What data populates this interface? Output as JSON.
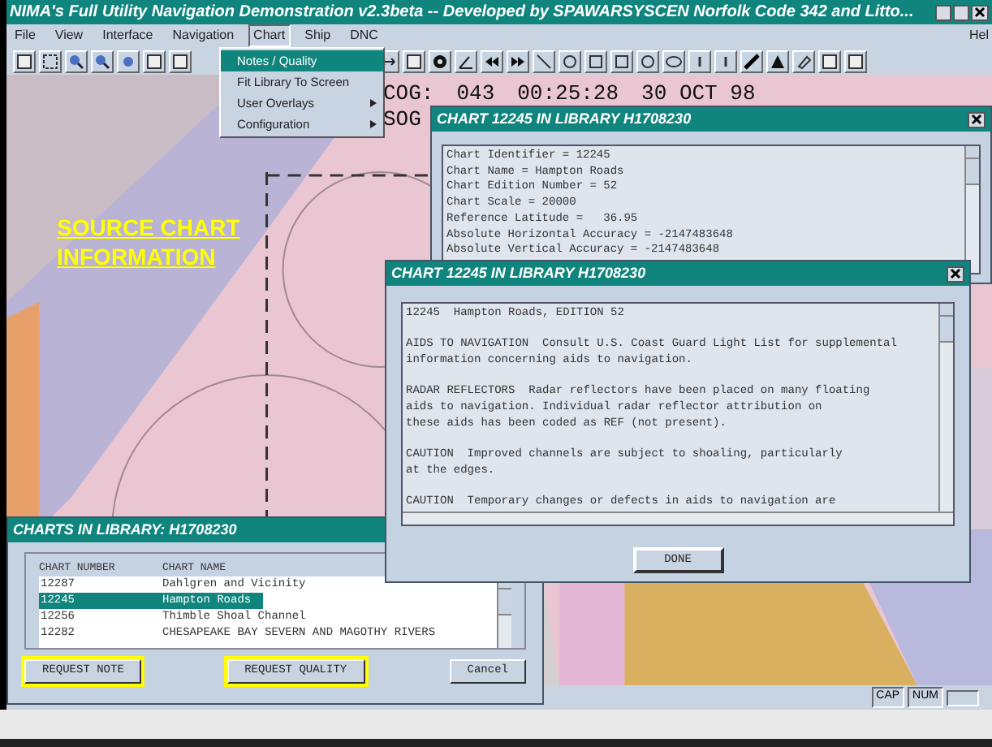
{
  "window": {
    "title": "NIMA's Full Utility Navigation Demonstration  v2.3beta -- Developed by SPAWARSYSCEN Norfolk Code 342 and Litto..."
  },
  "menu_bar": [
    {
      "label": "File",
      "selected": false
    },
    {
      "label": "View",
      "selected": false
    },
    {
      "label": "Interface",
      "selected": false
    },
    {
      "label": "Navigation",
      "selected": false
    },
    {
      "label": "Chart",
      "selected": true
    },
    {
      "label": "Ship",
      "selected": false
    },
    {
      "label": "DNC",
      "selected": false
    }
  ],
  "help_menu": "Hel",
  "chart_menu": [
    {
      "label": "Notes / Quality",
      "selected": true,
      "submenu": false
    },
    {
      "label": "Fit Library To Screen",
      "selected": false,
      "submenu": false
    },
    {
      "label": "User Overlays",
      "selected": false,
      "submenu": true
    },
    {
      "label": "Configuration",
      "selected": false,
      "submenu": true
    }
  ],
  "nav_readout": {
    "cog_label": "COG:",
    "cog": "043",
    "time": "00:25:28",
    "date": "30 OCT 98",
    "sog_label": "SOG"
  },
  "annotation": "SOURCE CHART INFORMATION",
  "info_window": {
    "title": "CHART 12245 IN LIBRARY H1708230",
    "lines": [
      "Chart Identifier = 12245",
      "Chart Name = Hampton Roads",
      "Chart Edition Number = 52",
      "Chart Scale = 20000",
      "Reference Latitude =   36.95",
      "Absolute Horizontal Accuracy = -2147483648",
      "Absolute Vertical Accuracy = -2147483648"
    ]
  },
  "notes_window": {
    "title": "CHART 12245 IN LIBRARY H1708230",
    "paragraphs": [
      "12245  Hampton Roads, EDITION 52",
      "AIDS TO NAVIGATION  Consult U.S. Coast Guard Light List for supplemental\ninformation concerning aids to navigation.",
      "RADAR REFLECTORS  Radar reflectors have been placed on many floating\naids to navigation. Individual radar reflector attribution on\nthese aids has been coded as REF (not present).",
      "CAUTION  Improved channels are subject to shoaling, particularly\nat the edges.",
      "CAUTION  Temporary changes or defects in aids to navigation are"
    ],
    "button": "DONE"
  },
  "library_window": {
    "title": "CHARTS IN LIBRARY: H1708230",
    "columns": [
      "CHART NUMBER",
      "CHART NAME"
    ],
    "rows": [
      {
        "number": "12287",
        "name": "Dahlgren and Vicinity",
        "selected": false
      },
      {
        "number": "12245",
        "name": "Hampton Roads",
        "selected": true
      },
      {
        "number": "12256",
        "name": "Thimble Shoal Channel",
        "selected": false
      },
      {
        "number": "12282",
        "name": "CHESAPEAKE BAY SEVERN AND MAGOTHY RIVERS",
        "selected": false
      }
    ],
    "buttons": [
      {
        "label": "REQUEST NOTE",
        "highlighted": true
      },
      {
        "label": "REQUEST QUALITY",
        "highlighted": true
      },
      {
        "label": "Cancel",
        "highlighted": false
      }
    ]
  },
  "status_bar": [
    "CAP",
    "NUM"
  ]
}
